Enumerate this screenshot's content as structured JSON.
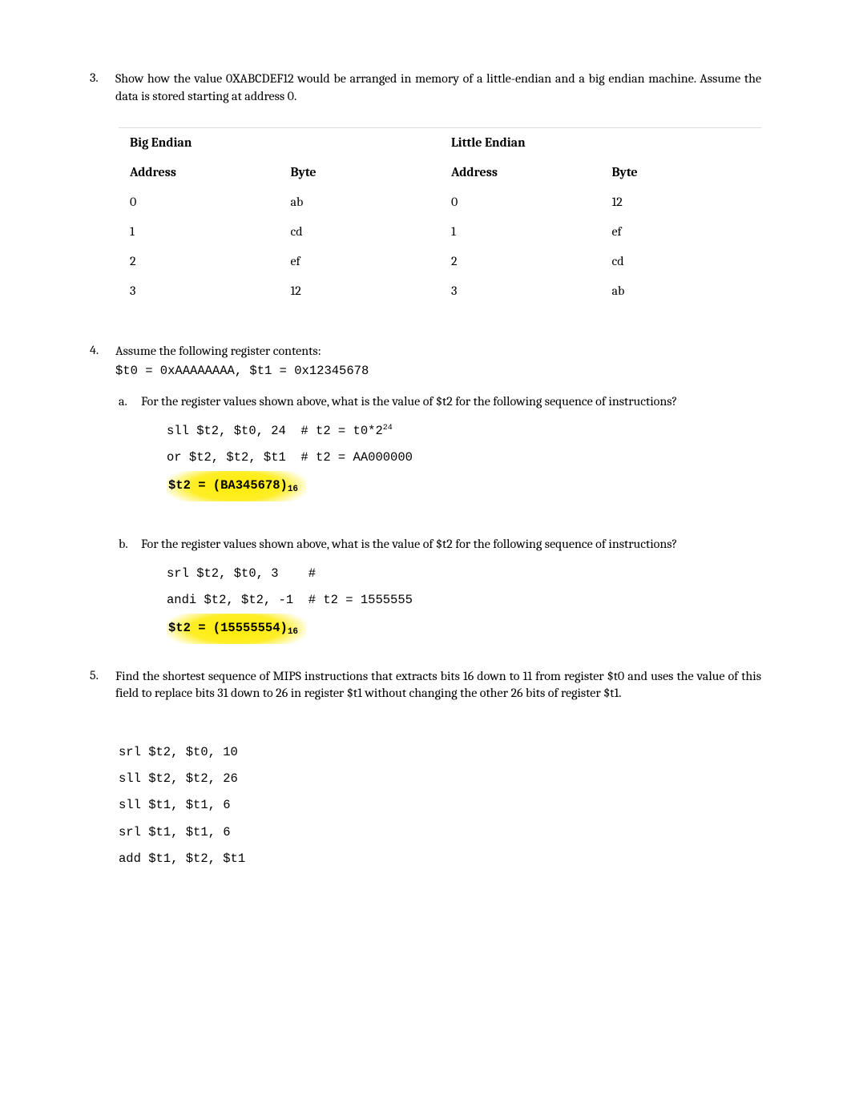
{
  "q3": {
    "num": "3.",
    "text": "Show how the value 0XABCDEF12 would be arranged in memory of a little-endian and a big endian machine. Assume the data is stored starting at address 0.",
    "table": {
      "headers": {
        "big": "Big Endian",
        "little": "Little Endian",
        "addr_b": "Address",
        "byte_b": "Byte",
        "addr_l": "Address",
        "byte_l": "Byte"
      },
      "rows": [
        {
          "ab": "0",
          "bb": "ab",
          "al": "0",
          "bl": "12"
        },
        {
          "ab": "1",
          "bb": "cd",
          "al": "1",
          "bl": "ef"
        },
        {
          "ab": "2",
          "bb": "ef",
          "al": "2",
          "bl": "cd"
        },
        {
          "ab": "3",
          "bb": "12",
          "al": "3",
          "bl": "ab"
        }
      ]
    }
  },
  "q4": {
    "num": "4.",
    "intro": "Assume the following register contents:",
    "regs": "$t0 = 0xAAAAAAAA, $t1 = 0x12345678",
    "a": {
      "letter": "a.",
      "text": "For the register values shown above, what is the value of $t2 for the following sequence of instructions?",
      "code_l1_pre": "sll $t2, $t0, 24  # t2 = t0*2",
      "code_l1_exp": "24",
      "code_l2": "or $t2, $t2, $t1  # t2 = AA000000",
      "answer_pre": "$t2 = (BA345678)",
      "answer_sub": "16"
    },
    "b": {
      "letter": "b.",
      "text": "For the register values shown above, what is the value of $t2 for the following sequence of instructions?",
      "code_l1": "srl $t2, $t0, 3    #",
      "code_l2": "andi $t2, $t2, -1  # t2 = 1555555",
      "answer_pre": "$t2 = (15555554)",
      "answer_sub": "16"
    }
  },
  "q5": {
    "num": "5.",
    "text": "Find the shortest sequence of MIPS instructions that extracts bits 16 down to 11 from register $t0 and uses the value of this field to replace bits 31 down to 26 in register $t1 without changing the other 26 bits of register $t1.",
    "code": "srl $t2, $t0, 10\nsll $t2, $t2, 26\nsll $t1, $t1, 6\nsrl $t1, $t1, 6\nadd $t1, $t2, $t1"
  }
}
